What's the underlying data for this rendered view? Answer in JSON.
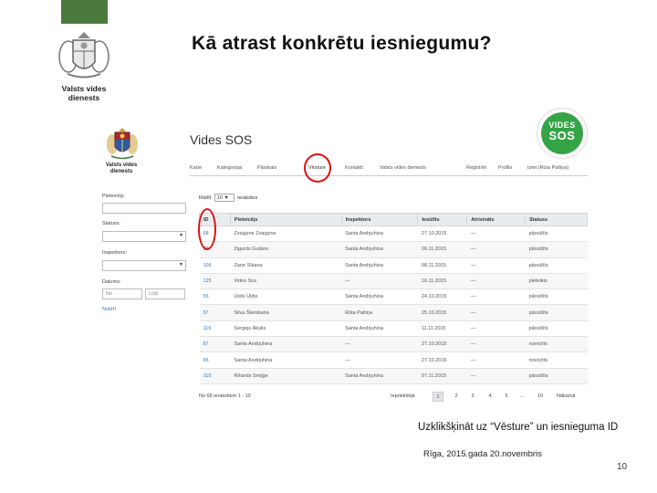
{
  "slide": {
    "title": "Kā atrast konkrētu iesniegumu?",
    "org_line1": "Valsts vides",
    "org_line2": "dienests",
    "caption": "Uzklikšķināt uz “Vēsture” un iesnieguma ID",
    "footer": "Rīga, 2015.gada 20.novembris",
    "page_number": "10",
    "accent_green": "#4a7a3e"
  },
  "app": {
    "org_line1": "Valsts vides",
    "org_line2": "dienests",
    "title": "Vides SOS",
    "logo_top": "VIDES",
    "logo_bottom": "SOS",
    "logo_color": "#35a447",
    "nav": [
      "Karte",
      "Kategorijas",
      "Pārskats",
      "Vēsture",
      "Kontakti",
      "Valsts vides dienests",
      "Reģistrēt",
      "Profils",
      "Iziet (Rūta Paltiņa)"
    ],
    "filters": {
      "location_label": "Pieteicējs:",
      "status_label": "Statuss:",
      "inspector_label": "Inspektors:",
      "date_label": "Datums:",
      "date_from_placeholder": "No",
      "date_to_placeholder": "Līdz",
      "clear_label": "Notīrīt"
    },
    "rows_prefix": "Rādīt",
    "rows_value": "10",
    "rows_suffix": "ierakstus",
    "table": {
      "headers": [
        "ID",
        "Pieteicējs",
        "Inspektors",
        "Iesūtīts",
        "Atrisināts",
        "Statuss"
      ],
      "rows": [
        [
          "68",
          "Zvaigzne Zvaigzne",
          "Santa Andrjuhina",
          "27.10.2015",
          "—",
          "pārsūtīts"
        ],
        [
          "69",
          "Zigurds Gutāns",
          "Santa Andrjuhina",
          "06.11.2015",
          "—",
          "pārsūtīts"
        ],
        [
          "106",
          "Zane Sīkana",
          "Santa Andrjuhina",
          "08.11.2015",
          "—",
          "pārsūtīts"
        ],
        [
          "125",
          "Vides Sos",
          "—",
          "16.11.2015",
          "—",
          "pieteikts"
        ],
        [
          "55",
          "Uldis Uldis",
          "Santa Andrjuhina",
          "24.10.2015",
          "—",
          "pārsūtīts"
        ],
        [
          "57",
          "Silva Šteinbaha",
          "Rūta Paltiņa",
          "25.10.2015",
          "—",
          "pārsūtīts"
        ],
        [
          "119",
          "Sergejs Ākulis",
          "Santa Andrjuhina",
          "11.11.2015",
          "—",
          "pārsūtīts"
        ],
        [
          "67",
          "Santa Andrjuhina",
          "—",
          "27.10.2015",
          "—",
          "novirzīts"
        ],
        [
          "66",
          "Santa Andrjuhina",
          "—",
          "27.10.2015",
          "—",
          "novirzīts"
        ],
        [
          "102",
          "Rihards Smiļģe",
          "Santa Andrjuhina",
          "07.11.2015",
          "—",
          "pārsūtīts"
        ]
      ]
    },
    "pager": {
      "info": "No 68 ierakstiem 1 - 10",
      "prev": "Iepriekšējā",
      "pages": [
        "1",
        "2",
        "3",
        "4",
        "5",
        "...",
        "10"
      ],
      "next": "Nākamā"
    }
  }
}
